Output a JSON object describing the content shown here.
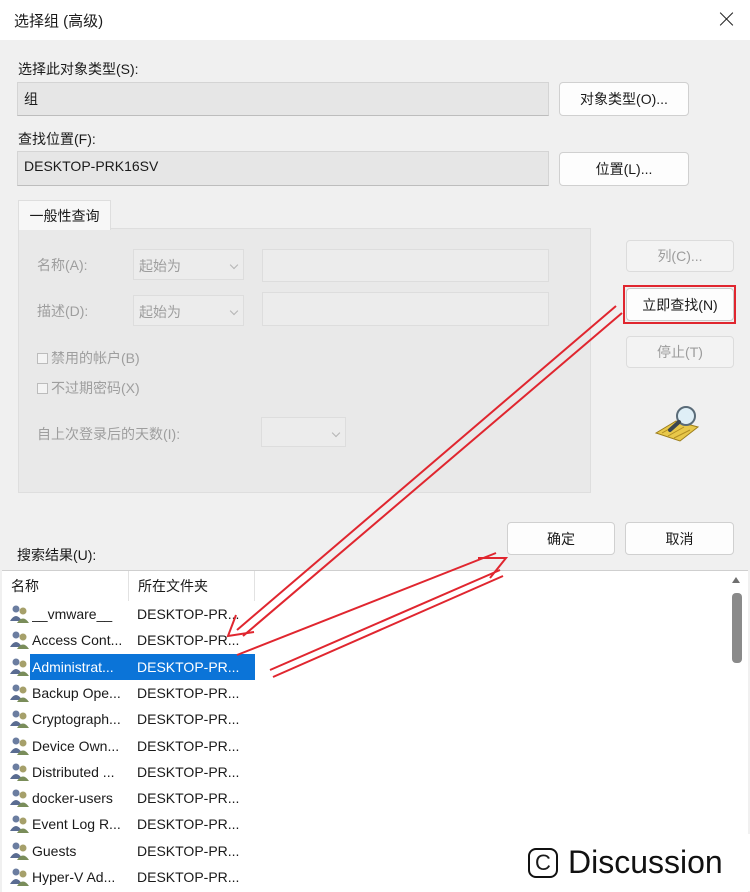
{
  "window": {
    "title": "选择组 (高级)"
  },
  "object_type": {
    "label": "选择此对象类型(S):",
    "value": "组",
    "button": "对象类型(O)..."
  },
  "location": {
    "label": "查找位置(F):",
    "value": "DESKTOP-PRK16SV",
    "button": "位置(L)..."
  },
  "query": {
    "tab": "一般性查询",
    "name_label": "名称(A):",
    "name_mode": "起始为",
    "desc_label": "描述(D):",
    "desc_mode": "起始为",
    "disabled_accounts": "禁用的帐户(B)",
    "non_expiring": "不过期密码(X)",
    "days_label": "自上次登录后的天数(I):"
  },
  "side_buttons": {
    "columns": "列(C)...",
    "find_now": "立即查找(N)",
    "stop": "停止(T)"
  },
  "dialog_buttons": {
    "ok": "确定",
    "cancel": "取消"
  },
  "results": {
    "label": "搜索结果(U):",
    "columns": [
      "名称",
      "所在文件夹"
    ],
    "rows": [
      {
        "name": "__vmware__",
        "folder": "DESKTOP-PR..."
      },
      {
        "name": "Access Cont...",
        "folder": "DESKTOP-PR..."
      },
      {
        "name": "Administrat...",
        "folder": "DESKTOP-PR...",
        "selected": true
      },
      {
        "name": "Backup Ope...",
        "folder": "DESKTOP-PR..."
      },
      {
        "name": "Cryptograph...",
        "folder": "DESKTOP-PR..."
      },
      {
        "name": "Device Own...",
        "folder": "DESKTOP-PR..."
      },
      {
        "name": "Distributed ...",
        "folder": "DESKTOP-PR..."
      },
      {
        "name": "docker-users",
        "folder": "DESKTOP-PR..."
      },
      {
        "name": "Event Log R...",
        "folder": "DESKTOP-PR..."
      },
      {
        "name": "Guests",
        "folder": "DESKTOP-PR..."
      },
      {
        "name": "Hyper-V Ad...",
        "folder": "DESKTOP-PR..."
      }
    ]
  },
  "watermark": {
    "symbol": "C",
    "text": "Discussion"
  },
  "colors": {
    "selection": "#0b74d8",
    "annotation": "#e0262f"
  }
}
